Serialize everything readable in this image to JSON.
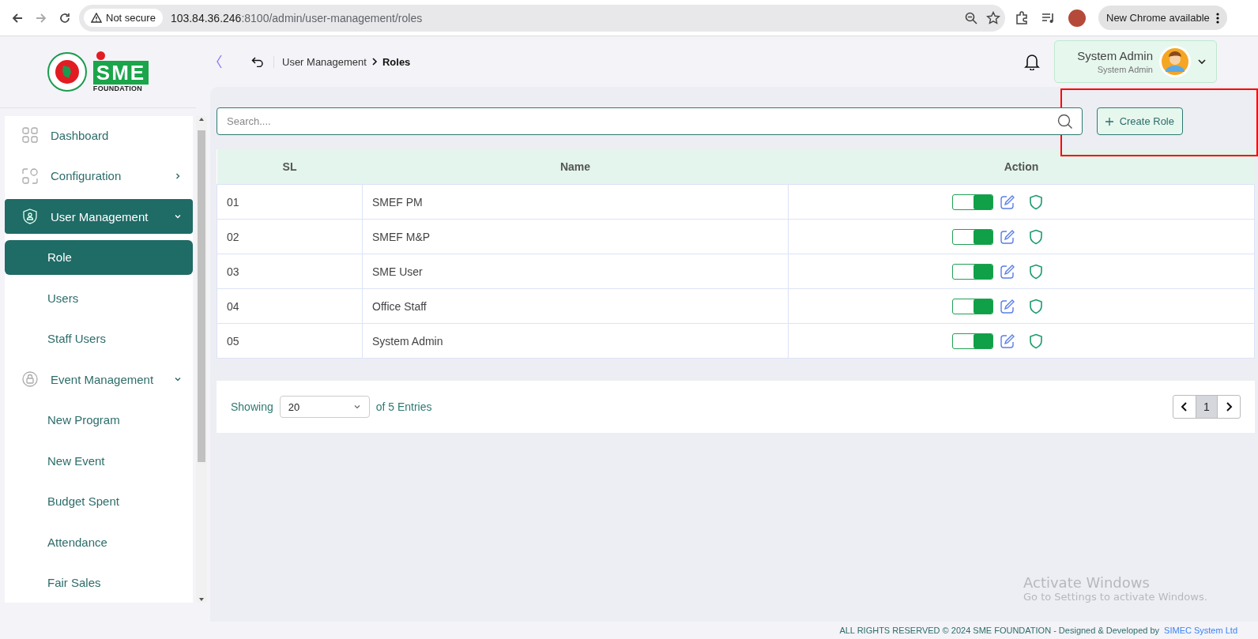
{
  "browser": {
    "security": "Not secure",
    "url_host": "103.84.36.246",
    "url_path": ":8100/admin/user-management/roles",
    "update": "New Chrome available"
  },
  "logo": {
    "mark": "SME",
    "subtitle": "FOUNDATION"
  },
  "breadcrumb": [
    {
      "label": "User Management",
      "current": false
    },
    {
      "label": "Roles",
      "current": true
    }
  ],
  "user": {
    "name": "System Admin",
    "role": "System Admin"
  },
  "sidebar": {
    "items": [
      {
        "label": "Dashboard",
        "kind": "link",
        "selected": false
      },
      {
        "label": "Configuration",
        "kind": "group",
        "selected": false,
        "expanded": false
      },
      {
        "label": "User Management",
        "kind": "group",
        "selected": true,
        "expanded": true,
        "children": [
          {
            "label": "Role",
            "selected": true
          },
          {
            "label": "Users",
            "selected": false
          },
          {
            "label": "Staff Users",
            "selected": false
          }
        ]
      },
      {
        "label": "Event Management",
        "kind": "group",
        "selected": false,
        "expanded": true,
        "children": [
          {
            "label": "New Program",
            "selected": false
          },
          {
            "label": "New Event",
            "selected": false
          },
          {
            "label": "Budget Spent",
            "selected": false
          },
          {
            "label": "Attendance",
            "selected": false
          },
          {
            "label": "Fair Sales",
            "selected": false
          }
        ]
      }
    ]
  },
  "search": {
    "placeholder": "Search...."
  },
  "create_button": {
    "label": "Create Role"
  },
  "table": {
    "columns": [
      "SL",
      "Name",
      "Action"
    ],
    "rows": [
      {
        "sl": "01",
        "name": "SMEF PM",
        "active": true
      },
      {
        "sl": "02",
        "name": "SMEF M&P",
        "active": true
      },
      {
        "sl": "03",
        "name": "SME User",
        "active": true
      },
      {
        "sl": "04",
        "name": "Office Staff",
        "active": true
      },
      {
        "sl": "05",
        "name": "System Admin",
        "active": true
      }
    ]
  },
  "pager": {
    "label": "Showing",
    "page_size": "20",
    "suffix": "of 5 Entries",
    "pages": [
      {
        "label": "1",
        "selected": true
      }
    ]
  },
  "windows_notice": {
    "title": "Activate Windows",
    "text": "Go to Settings to activate Windows."
  },
  "footer": {
    "text": "ALL RIGHTS RESERVED © 2024 SME FOUNDATION - Designed & Developed by",
    "link": "SIMEC System Ltd"
  }
}
